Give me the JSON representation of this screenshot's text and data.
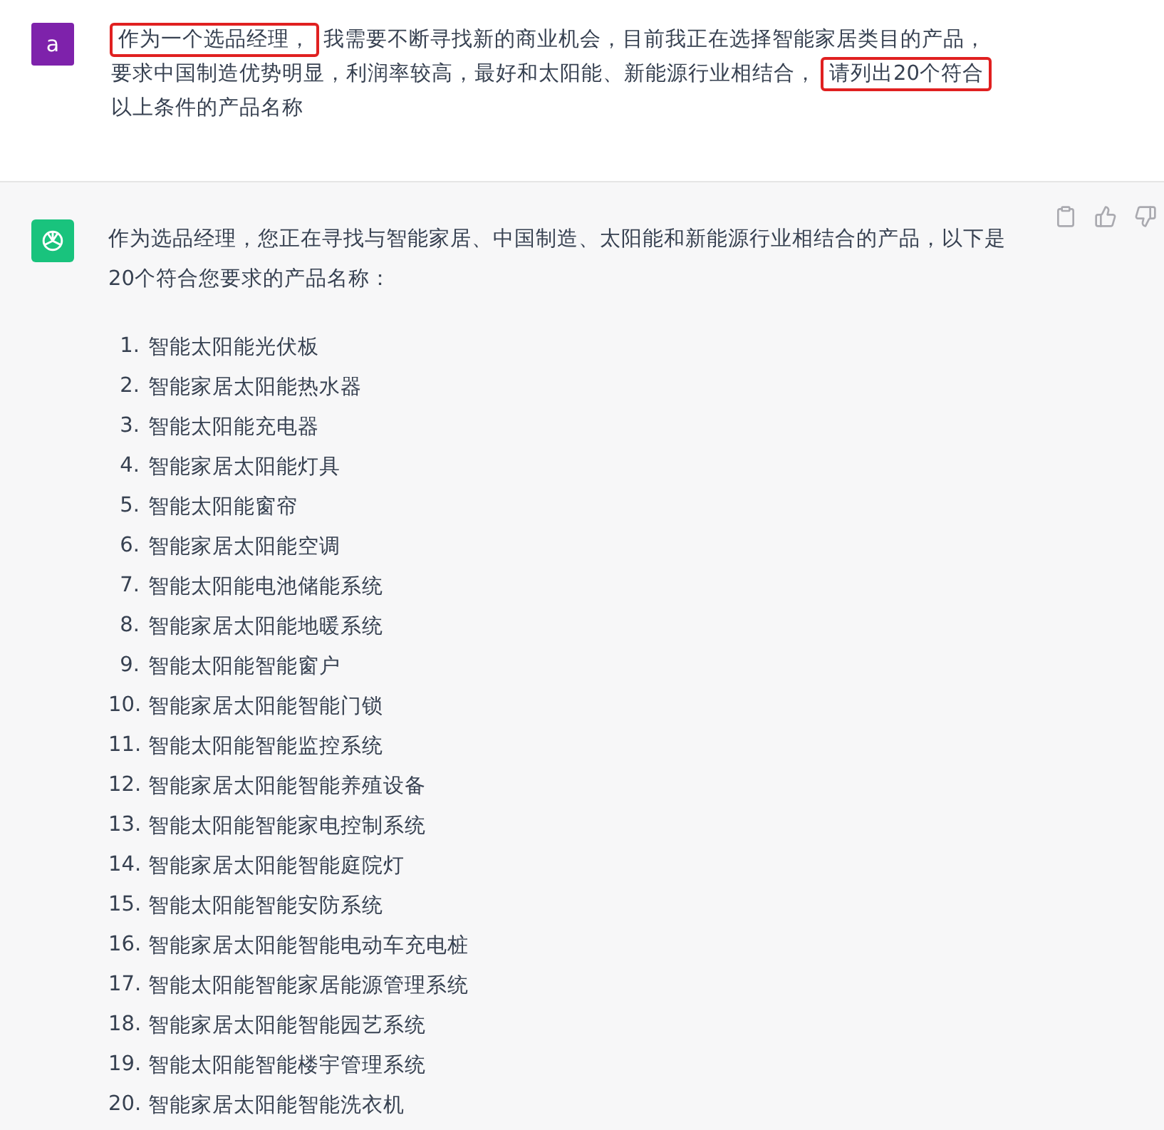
{
  "user_message": {
    "avatar": "a",
    "lines": [
      [
        {
          "text": "作为一个选品经理，",
          "highlighted": true
        },
        {
          "text": "我需要不断寻找新的商业机会，目前我正在选择智能家居类目的产品，",
          "highlighted": false
        }
      ],
      [
        {
          "text": "要求中国制造优势明显，利润率较高，最好和太阳能、新能源行业相结合，",
          "highlighted": false
        },
        {
          "text": "请列出20个符合",
          "highlighted": true
        }
      ],
      [
        {
          "text": "以上条件的产品名称",
          "highlighted": false
        }
      ]
    ]
  },
  "response": {
    "intro": "作为选品经理，您正在寻找与智能家居、中国制造、太阳能和新能源行业相结合的产品，以下是20个符合您要求的产品名称：",
    "items": [
      {
        "number": "1.",
        "text": "智能太阳能光伏板"
      },
      {
        "number": "2.",
        "text": "智能家居太阳能热水器"
      },
      {
        "number": "3.",
        "text": "智能太阳能充电器"
      },
      {
        "number": "4.",
        "text": "智能家居太阳能灯具"
      },
      {
        "number": "5.",
        "text": "智能太阳能窗帘"
      },
      {
        "number": "6.",
        "text": "智能家居太阳能空调"
      },
      {
        "number": "7.",
        "text": "智能太阳能电池储能系统"
      },
      {
        "number": "8.",
        "text": "智能家居太阳能地暖系统"
      },
      {
        "number": "9.",
        "text": "智能太阳能智能窗户"
      },
      {
        "number": "10.",
        "text": "智能家居太阳能智能门锁"
      },
      {
        "number": "11.",
        "text": "智能太阳能智能监控系统"
      },
      {
        "number": "12.",
        "text": "智能家居太阳能智能养殖设备"
      },
      {
        "number": "13.",
        "text": "智能太阳能智能家电控制系统"
      },
      {
        "number": "14.",
        "text": "智能家居太阳能智能庭院灯"
      },
      {
        "number": "15.",
        "text": "智能太阳能智能安防系统"
      },
      {
        "number": "16.",
        "text": "智能家居太阳能智能电动车充电桩"
      },
      {
        "number": "17.",
        "text": "智能太阳能智能家居能源管理系统"
      },
      {
        "number": "18.",
        "text": "智能家居太阳能智能园艺系统"
      },
      {
        "number": "19.",
        "text": "智能太阳能智能楼宇管理系统"
      },
      {
        "number": "20.",
        "text": "智能家居太阳能智能洗衣机"
      }
    ]
  }
}
